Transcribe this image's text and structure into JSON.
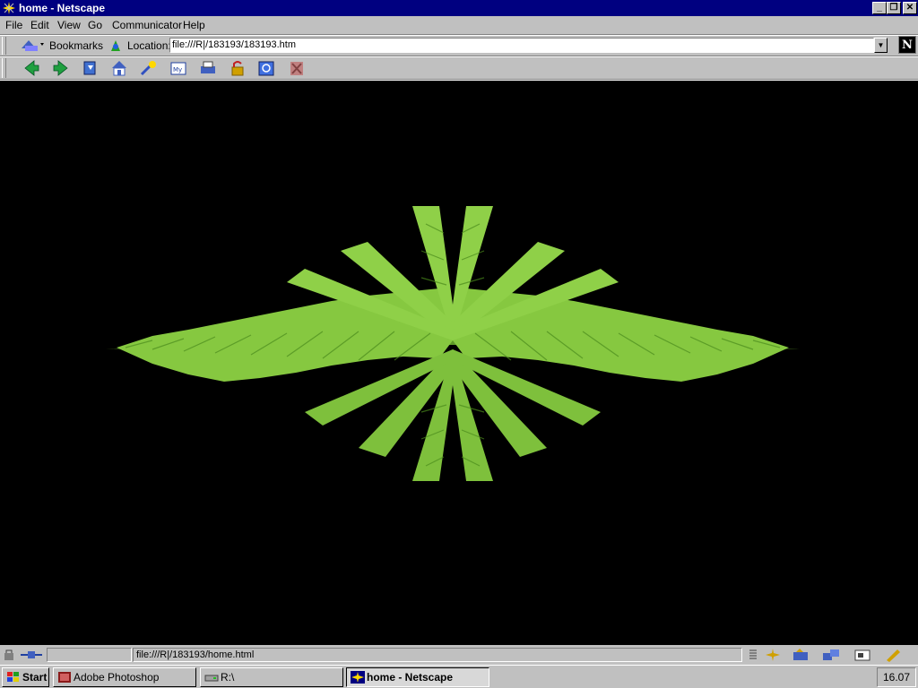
{
  "window": {
    "title": "home - Netscape",
    "minimize": "_",
    "restore": "❐",
    "close": "✕"
  },
  "menu": [
    "File",
    "Edit",
    "View",
    "Go",
    "Communicator",
    "Help"
  ],
  "location_bar": {
    "bookmarks_label": "Bookmarks",
    "location_label": "Location:",
    "url": "file:///R|/183193/183193.htm",
    "logo": "N"
  },
  "nav_buttons": [
    "back-icon",
    "forward-icon",
    "reload-icon",
    "home-icon",
    "search-icon",
    "my-netscape-icon",
    "print-icon",
    "security-icon",
    "shop-icon",
    "stop-icon"
  ],
  "status_bar": {
    "status_text": "file:///R|/183193/home.html"
  },
  "taskbar": {
    "start_label": "Start",
    "tasks": [
      "Adobe Photoshop",
      "R:\\",
      "home - Netscape"
    ],
    "clock": "16.07"
  },
  "colors": {
    "title_bar": "#000080",
    "chrome": "#c0c0c0",
    "content_bg": "#000000",
    "fern": "#7dbd3a"
  }
}
